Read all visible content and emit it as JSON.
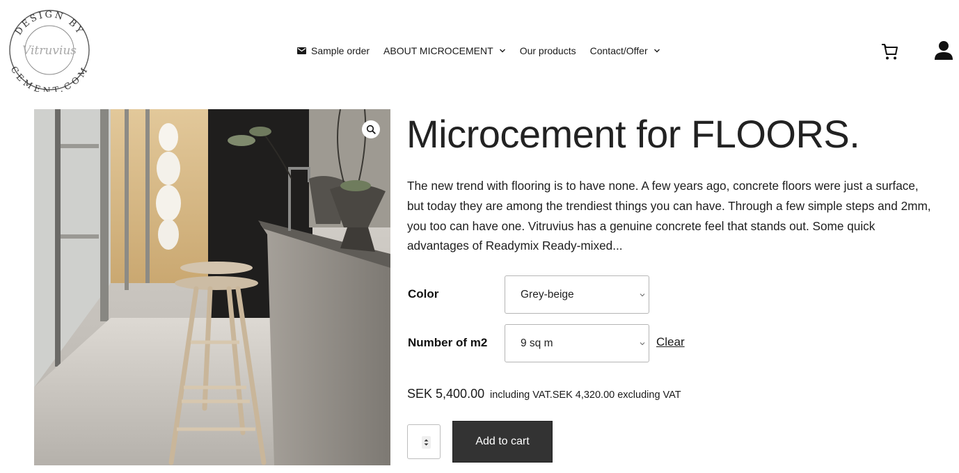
{
  "header": {
    "logo": {
      "top_text": "DESIGN BY",
      "center_text": "Vitruvius",
      "bottom_text": "CEMENT.COM"
    },
    "nav": [
      {
        "label": "Sample order",
        "icon": "mail-icon",
        "has_dropdown": false
      },
      {
        "label": "ABOUT MICROCEMENT",
        "has_dropdown": true
      },
      {
        "label": "Our products",
        "has_dropdown": false
      },
      {
        "label": "Contact/Offer",
        "has_dropdown": true
      }
    ],
    "cart_icon": "cart-icon",
    "account_icon": "user-icon"
  },
  "product": {
    "image_alt": "Concrete floor with bar stools and kitchen counter",
    "zoom_icon": "magnifier-icon",
    "title": "Microcement for FLOORS.",
    "description": "The new trend with flooring is to have none. A few years ago, concrete floors were just a surface, but today they are among the trendiest things you can have. Through a few simple steps and 2mm, you too can have one. Vitruvius has a genuine concrete feel that stands out. Some quick advantages of Readymix Ready-mixed...",
    "variations": [
      {
        "label": "Color",
        "selected": "Grey-beige"
      },
      {
        "label": "Number of m2",
        "selected": "9 sq m"
      }
    ],
    "clear_label": "Clear",
    "price": "SEK 5,400.00",
    "price_suffix": "including VAT.SEK 4,320.00 excluding VAT",
    "quantity": "",
    "add_to_cart_label": "Add to cart"
  },
  "colors": {
    "button_bg": "#333333",
    "text": "#1a1a1a",
    "border": "#b5b5b5"
  }
}
